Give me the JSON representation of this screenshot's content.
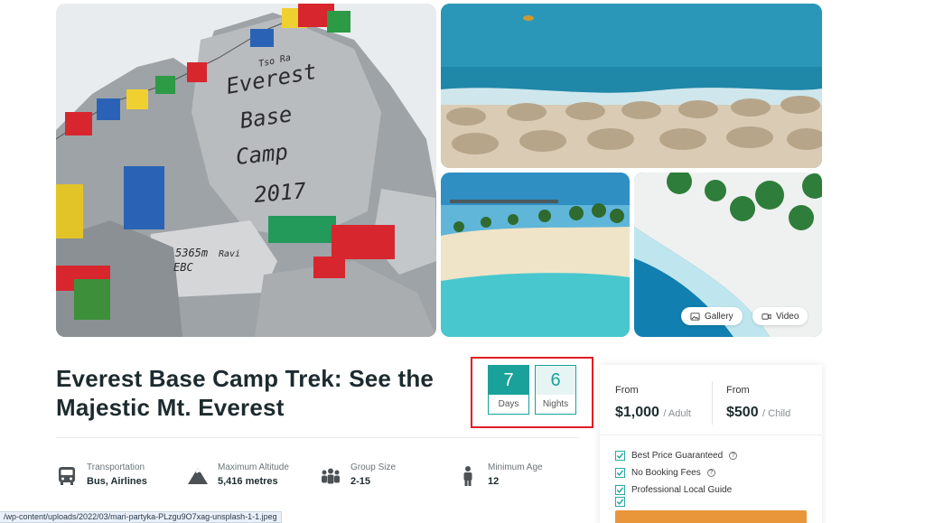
{
  "gallery": {
    "photos": [
      "everest-base-camp-rock",
      "beach-umbrellas",
      "lagoon-beach",
      "aerial-shoreline"
    ],
    "gallery_label": "Gallery",
    "video_label": "Video",
    "main_photo_text": [
      "Everest",
      "Base",
      "Camp",
      "2017",
      "5365m",
      "EBC",
      "Ravi",
      "Tso Ra"
    ]
  },
  "trip": {
    "title": "Everest Base Camp Trek: See the Majestic Mt. Everest"
  },
  "duration": {
    "days_value": "7",
    "days_label": "Days",
    "nights_value": "6",
    "nights_label": "Nights",
    "highlight_color": "#e31b23"
  },
  "pricing": {
    "adult": {
      "from_label": "From",
      "amount": "$1,000",
      "per": "/ Adult"
    },
    "child": {
      "from_label": "From",
      "amount": "$500",
      "per": "/ Child"
    },
    "features": [
      {
        "label": "Best Price Guaranteed",
        "help_icon": true
      },
      {
        "label": "No Booking Fees",
        "help_icon": true
      },
      {
        "label": "Professional Local Guide",
        "help_icon": false
      }
    ],
    "accent_color": "#1aa19a",
    "book_button_color": "#e9963a"
  },
  "info": [
    {
      "icon": "bus-icon",
      "label": "Transportation",
      "value": "Bus, Airlines"
    },
    {
      "icon": "mountain-icon",
      "label": "Maximum Altitude",
      "value": "5,416 metres"
    },
    {
      "icon": "group-icon",
      "label": "Group Size",
      "value": "2-15"
    },
    {
      "icon": "person-icon",
      "label": "Minimum Age",
      "value": "12"
    }
  ],
  "status_bar": {
    "url": "/wp-content/uploads/2022/03/mari-partyka-PLzgu9O7xag-unsplash-1-1.jpeg"
  }
}
